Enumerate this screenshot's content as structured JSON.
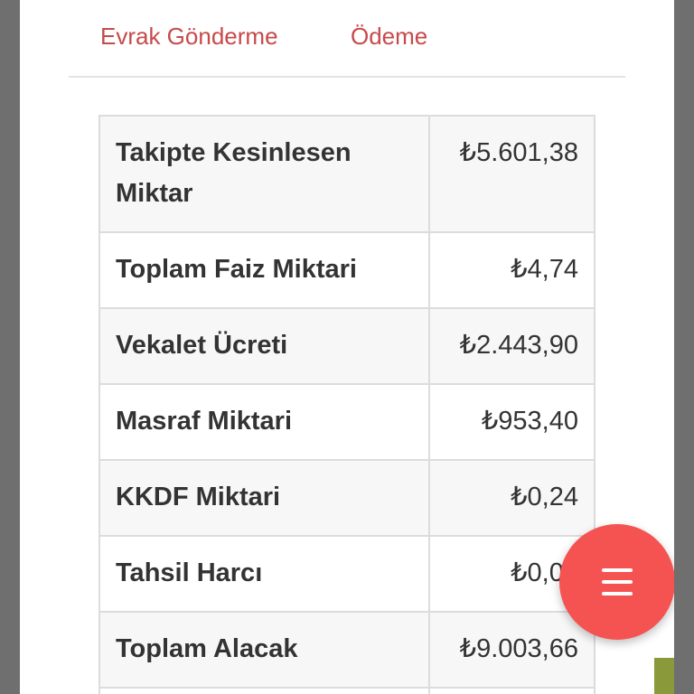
{
  "tabs": [
    {
      "label": "Evrak Gönderme"
    },
    {
      "label": "Ödeme"
    }
  ],
  "summary_table": {
    "rows": [
      {
        "label": "Takipte Kesinlesen Miktar",
        "value": "₺5.601,38"
      },
      {
        "label": "Toplam Faiz Miktari",
        "value": "₺4,74"
      },
      {
        "label": "Vekalet Ücreti",
        "value": "₺2.443,90"
      },
      {
        "label": "Masraf Miktari",
        "value": "₺953,40"
      },
      {
        "label": "KKDF Miktari",
        "value": "₺0,24"
      },
      {
        "label": "Tahsil Harcı",
        "value": "₺0,00"
      },
      {
        "label": "Toplam Alacak",
        "value": "₺9.003,66"
      },
      {
        "label": "",
        "value": ""
      }
    ]
  },
  "fab": {
    "icon": "menu-icon"
  },
  "colors": {
    "tab_text": "#c74a4a",
    "fab_background": "#f55352",
    "table_border": "#dcdcdc",
    "row_stripe": "#f7f7f7"
  }
}
